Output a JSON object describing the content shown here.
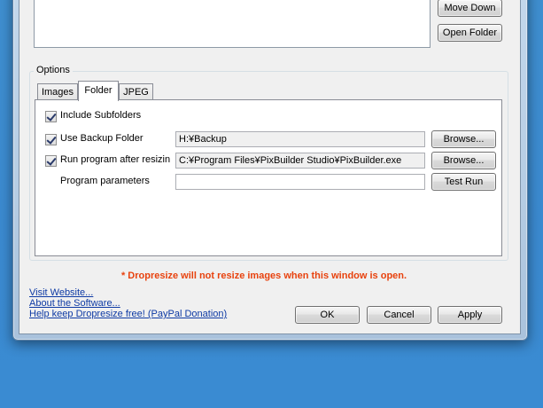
{
  "right_buttons": {
    "move_down": "Move Down",
    "open_folder": "Open Folder"
  },
  "options": {
    "group_label": "Options",
    "tabs": [
      {
        "label": "Images",
        "active": false
      },
      {
        "label": "Folder",
        "active": true
      },
      {
        "label": "JPEG",
        "active": false
      }
    ],
    "include_subfolders": {
      "label": "Include Subfolders",
      "checked": true
    },
    "use_backup": {
      "label": "Use Backup Folder",
      "checked": true,
      "value": "H:¥Backup",
      "browse": "Browse..."
    },
    "run_program": {
      "label": "Run program after resizin",
      "checked": true,
      "value": "C:¥Program Files¥PixBuilder Studio¥PixBuilder.exe",
      "browse": "Browse..."
    },
    "program_parameters": {
      "label": "Program parameters",
      "value": "",
      "test_run": "Test Run"
    }
  },
  "warning": "* Dropresize will not resize images when this window is open.",
  "links": {
    "visit_website": "Visit Website...",
    "about": "About the Software...",
    "donate": "Help keep Dropresize free! (PayPal Donation)"
  },
  "dialog_buttons": {
    "ok": "OK",
    "cancel": "Cancel",
    "apply": "Apply"
  }
}
